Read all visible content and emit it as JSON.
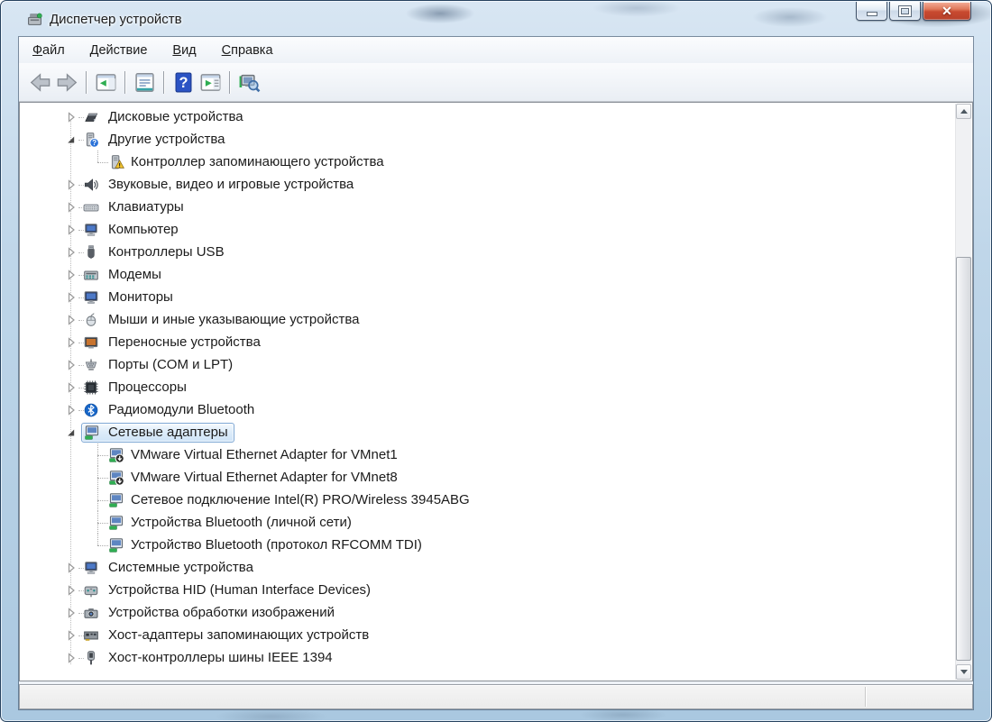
{
  "window": {
    "title": "Диспетчер устройств",
    "icon": "device-manager-icon",
    "controls": [
      "minimize",
      "maximize",
      "close"
    ]
  },
  "menu": {
    "items": [
      {
        "accel": "Ф",
        "rest": "айл"
      },
      {
        "accel": "Д",
        "rest": "ействие"
      },
      {
        "accel": "В",
        "rest": "ид"
      },
      {
        "accel": "С",
        "rest": "правка"
      }
    ]
  },
  "toolbar": {
    "icons": [
      "back-icon",
      "forward-icon",
      "show-console-tree-icon",
      "properties-icon",
      "help-icon",
      "show-action-pane-icon",
      "scan-hardware-changes-icon"
    ]
  },
  "tree": {
    "items": [
      {
        "label": "Дисковые устройства",
        "icon": "disk-drive-icon",
        "level": 0,
        "state": "collapsed"
      },
      {
        "label": "Другие устройства",
        "icon": "unknown-device-icon",
        "level": 0,
        "state": "expanded"
      },
      {
        "label": "Контроллер запоминающего устройства",
        "icon": "storage-controller-warning-icon",
        "level": 1,
        "badge": "warning"
      },
      {
        "label": "Звуковые, видео и игровые устройства",
        "icon": "audio-device-icon",
        "level": 0,
        "state": "collapsed"
      },
      {
        "label": "Клавиатуры",
        "icon": "keyboard-icon",
        "level": 0,
        "state": "collapsed"
      },
      {
        "label": "Компьютер",
        "icon": "computer-icon",
        "level": 0,
        "state": "collapsed"
      },
      {
        "label": "Контроллеры USB",
        "icon": "usb-controller-icon",
        "level": 0,
        "state": "collapsed"
      },
      {
        "label": "Модемы",
        "icon": "modem-icon",
        "level": 0,
        "state": "collapsed"
      },
      {
        "label": "Мониторы",
        "icon": "monitor-icon",
        "level": 0,
        "state": "collapsed"
      },
      {
        "label": "Мыши и иные указывающие устройства",
        "icon": "mouse-icon",
        "level": 0,
        "state": "collapsed"
      },
      {
        "label": "Переносные устройства",
        "icon": "portable-device-icon",
        "level": 0,
        "state": "collapsed"
      },
      {
        "label": "Порты (COM и LPT)",
        "icon": "port-icon",
        "level": 0,
        "state": "collapsed"
      },
      {
        "label": "Процессоры",
        "icon": "processor-icon",
        "level": 0,
        "state": "collapsed"
      },
      {
        "label": "Радиомодули Bluetooth",
        "icon": "bluetooth-icon",
        "level": 0,
        "state": "collapsed"
      },
      {
        "label": "Сетевые адаптеры",
        "icon": "network-adapter-icon",
        "level": 0,
        "state": "expanded",
        "selected": true
      },
      {
        "label": "VMware Virtual Ethernet Adapter for VMnet1",
        "icon": "network-adapter-disabled-icon",
        "level": 1,
        "badge": "disabled"
      },
      {
        "label": "VMware Virtual Ethernet Adapter for VMnet8",
        "icon": "network-adapter-disabled-icon",
        "level": 1,
        "badge": "disabled"
      },
      {
        "label": "Сетевое подключение Intel(R) PRO/Wireless 3945ABG",
        "icon": "network-adapter-icon",
        "level": 1
      },
      {
        "label": "Устройства Bluetooth (личной сети)",
        "icon": "network-adapter-icon",
        "level": 1
      },
      {
        "label": "Устройство Bluetooth (протокол RFCOMM TDI)",
        "icon": "network-adapter-icon",
        "level": 1
      },
      {
        "label": "Системные устройства",
        "icon": "system-devices-icon",
        "level": 0,
        "state": "collapsed"
      },
      {
        "label": "Устройства HID (Human Interface Devices)",
        "icon": "hid-device-icon",
        "level": 0,
        "state": "collapsed"
      },
      {
        "label": "Устройства обработки изображений",
        "icon": "imaging-device-icon",
        "level": 0,
        "state": "collapsed"
      },
      {
        "label": "Хост-адаптеры запоминающих устройств",
        "icon": "storage-host-adapter-icon",
        "level": 0,
        "state": "collapsed"
      },
      {
        "label": "Хост-контроллеры шины IEEE 1394",
        "icon": "ieee1394-icon",
        "level": 0,
        "state": "collapsed"
      }
    ]
  },
  "statusbar": {
    "left_text": "",
    "right_text": ""
  }
}
